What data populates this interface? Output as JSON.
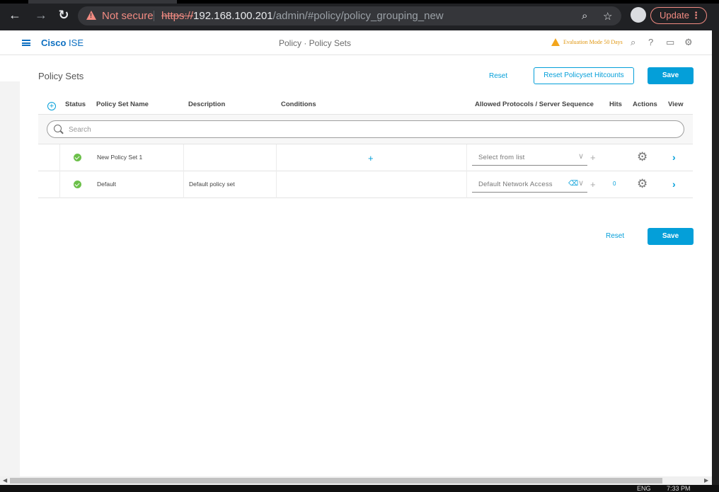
{
  "browser": {
    "security_label": "Not secure",
    "url_scheme": "https://",
    "url_host": "192.168.100.201",
    "url_path": "/admin/#policy/policy_grouping_new",
    "update_label": "Update"
  },
  "header": {
    "brand_bold": "Cisco",
    "brand_light": "ISE",
    "title": "Policy · Policy Sets",
    "eval_notice": "Evaluation Mode 50 Days"
  },
  "page": {
    "title": "Policy Sets",
    "reset_label": "Reset",
    "reset_hitcounts_label": "Reset Policyset Hitcounts",
    "save_label": "Save"
  },
  "table": {
    "columns": {
      "status": "Status",
      "name": "Policy Set Name",
      "description": "Description",
      "conditions": "Conditions",
      "protocols": "Allowed Protocols / Server Sequence",
      "hits": "Hits",
      "actions": "Actions",
      "view": "View"
    },
    "search_placeholder": "Search",
    "rows": [
      {
        "status": "enabled",
        "name": "New Policy Set 1",
        "description": "",
        "protocol": "Select from list",
        "hits": ""
      },
      {
        "status": "enabled",
        "name": "Default",
        "description": "Default policy set",
        "protocol": "Default Network Access",
        "hits": "0"
      }
    ]
  },
  "taskbar": {
    "lang": "ENG",
    "time": "7:33 PM"
  },
  "colors": {
    "primary": "#049fd9",
    "brand": "#0c6fc1",
    "status_ok": "#6cc04a",
    "warning": "#f3a51c",
    "not_secure": "#f28b82"
  },
  "icons": {
    "status": "check-circle-icon",
    "actions": "gear-icon",
    "view": "chevron-right-icon",
    "add": "plus-circle-icon",
    "search": "search-icon"
  }
}
